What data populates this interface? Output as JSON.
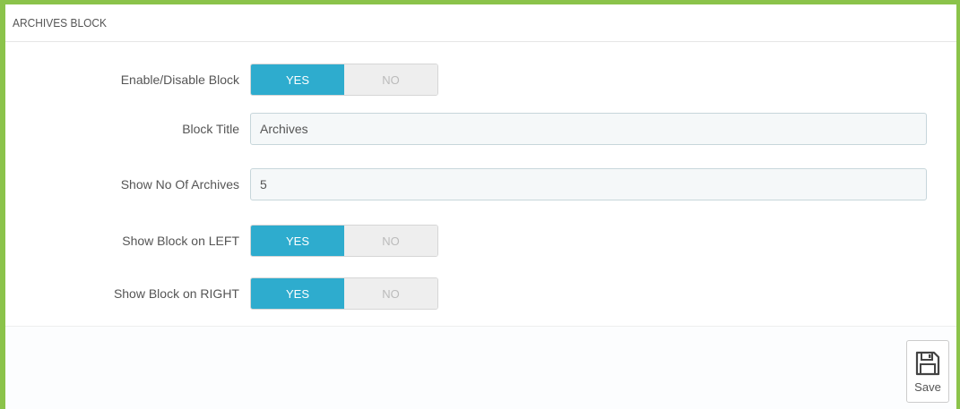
{
  "panel": {
    "title": "ARCHIVES BLOCK"
  },
  "fields": {
    "enable_block": {
      "label": "Enable/Disable Block",
      "yes": "YES",
      "no": "NO",
      "value": "YES"
    },
    "block_title": {
      "label": "Block Title",
      "value": "Archives"
    },
    "show_no_archives": {
      "label": "Show No Of Archives",
      "value": "5"
    },
    "show_left": {
      "label": "Show Block on LEFT",
      "yes": "YES",
      "no": "NO",
      "value": "YES"
    },
    "show_right": {
      "label": "Show Block on RIGHT",
      "yes": "YES",
      "no": "NO",
      "value": "YES"
    }
  },
  "footer": {
    "save_label": "Save",
    "save_icon": "floppy-disk-icon"
  },
  "colors": {
    "frame_border": "#8bc34a",
    "switch_active": "#2eacce",
    "switch_inactive": "#eeeeee"
  }
}
